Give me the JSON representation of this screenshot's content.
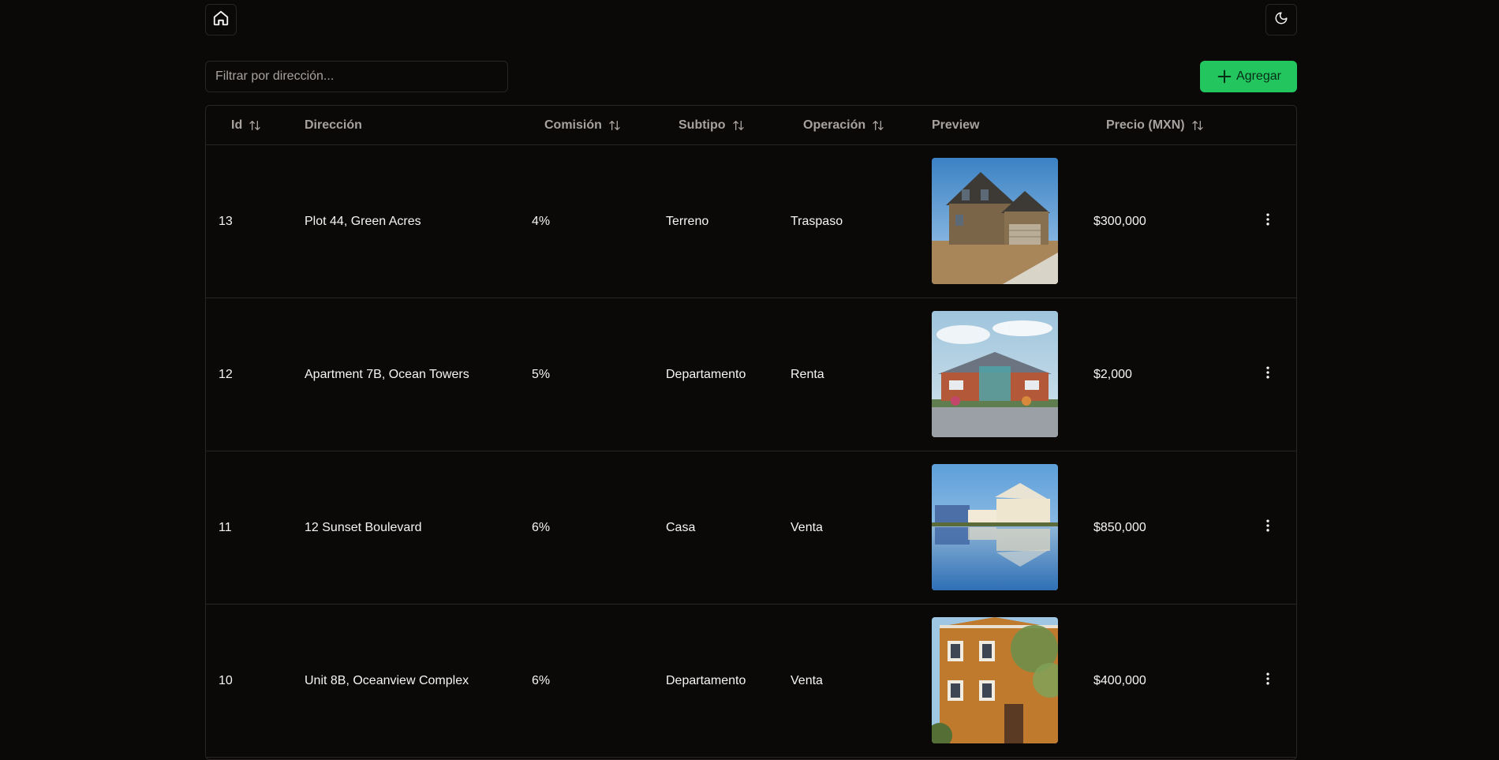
{
  "header": {
    "home_icon": "home-icon",
    "theme_icon": "moon-icon"
  },
  "toolbar": {
    "filter_placeholder": "Filtrar por dirección...",
    "add_label": "Agregar",
    "add_icon": "plus-icon",
    "accent_color": "#22c55e"
  },
  "table": {
    "columns": [
      {
        "label": "Id",
        "sortable": true
      },
      {
        "label": "Dirección",
        "sortable": false
      },
      {
        "label": "Comisión",
        "sortable": true
      },
      {
        "label": "Subtipo",
        "sortable": true
      },
      {
        "label": "Operación",
        "sortable": true
      },
      {
        "label": "Preview",
        "sortable": false
      },
      {
        "label": "Precio (MXN)",
        "sortable": true
      }
    ],
    "rows": [
      {
        "id": "13",
        "direccion": "Plot 44, Green Acres",
        "comision": "4%",
        "subtipo": "Terreno",
        "operacion": "Traspaso",
        "precio": "$300,000",
        "preview": "two-story-wood-house-photo"
      },
      {
        "id": "12",
        "direccion": "Apartment 7B, Ocean Towers",
        "comision": "5%",
        "subtipo": "Departamento",
        "operacion": "Renta",
        "precio": "$2,000",
        "preview": "brick-bungalow-photo"
      },
      {
        "id": "11",
        "direccion": "12 Sunset Boulevard",
        "comision": "6%",
        "subtipo": "Casa",
        "operacion": "Venta",
        "precio": "$850,000",
        "preview": "lakeside-house-photo"
      },
      {
        "id": "10",
        "direccion": "Unit 8B, Oceanview Complex",
        "comision": "6%",
        "subtipo": "Departamento",
        "operacion": "Venta",
        "precio": "$400,000",
        "preview": "orange-townhouse-photo"
      }
    ],
    "row_menu_icon": "more-vertical-icon"
  }
}
